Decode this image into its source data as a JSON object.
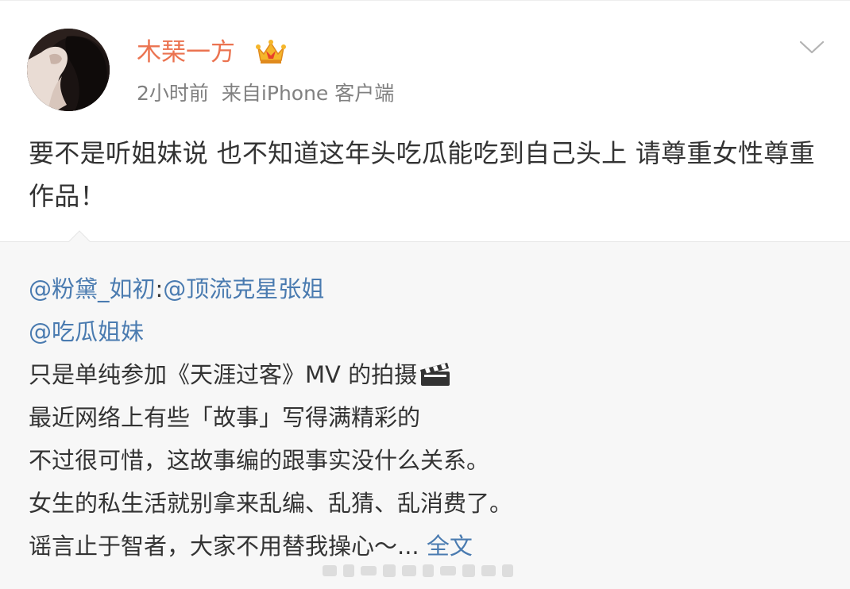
{
  "post": {
    "author": {
      "name": "木琹一方",
      "avatar_icon": "avatar-woman-dark-hair",
      "badge_icon": "crown-icon",
      "name_color": "#eb7350"
    },
    "meta": {
      "time": "2小时前",
      "source_prefix": "来自",
      "source_name": "iPhone 客户端"
    },
    "menu_icon": "chevron-down-icon",
    "content": "要不是听姐妹说 也不知道这年头吃瓜能吃到自己头上 请尊重女性尊重作品！"
  },
  "repost": {
    "author_mention": "@粉黛_如初",
    "colon": ":",
    "mention_1": "@顶流克星张姐",
    "mention_2": "@吃瓜姐妹",
    "line_3": "只是单纯参加《天涯过客》MV 的拍摄",
    "line_3_icon": "clapper-board-icon",
    "line_4": "最近网络上有些「故事」写得满精彩的",
    "line_5": "不过很可惜，这故事编的跟事实没什么关系。",
    "line_6": "女生的私生活就别拿来乱编、乱猜、乱消费了。",
    "line_7": "谣言止于智者，大家不用替我操心～... ",
    "full_text_link": "全文",
    "link_color": "#4a7bb0",
    "background": "#f7f7f7"
  }
}
